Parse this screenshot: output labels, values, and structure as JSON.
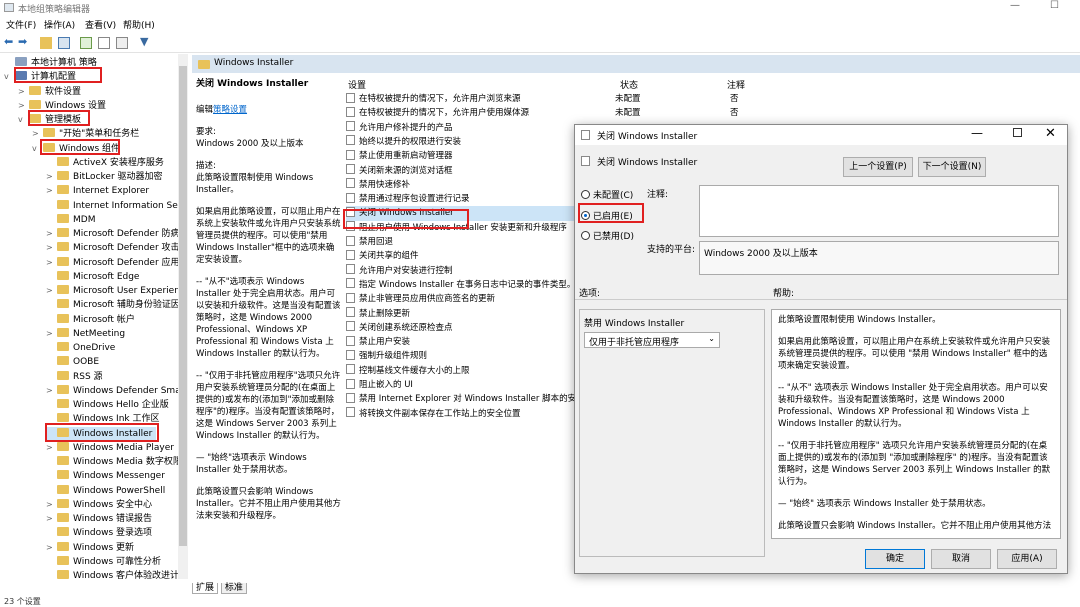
{
  "window": {
    "title": "本地组策略编辑器",
    "min": "—",
    "max": "☐"
  },
  "menu": {
    "file": "文件(F)",
    "action": "操作(A)",
    "view": "查看(V)",
    "help": "帮助(H)"
  },
  "tree": {
    "items": [
      {
        "label": "本地计算机 策略",
        "level": 0,
        "exp": ""
      },
      {
        "label": "计算机配置",
        "level": 0,
        "exp": "v"
      },
      {
        "label": "软件设置",
        "level": 1,
        "exp": ">"
      },
      {
        "label": "Windows 设置",
        "level": 1,
        "exp": ">"
      },
      {
        "label": "管理模板",
        "level": 1,
        "exp": "v"
      },
      {
        "label": "\"开始\"菜单和任务栏",
        "level": 2,
        "exp": ">"
      },
      {
        "label": "Windows 组件",
        "level": 2,
        "exp": "v"
      },
      {
        "label": "ActiveX 安装程序服务",
        "level": 3,
        "exp": ""
      },
      {
        "label": "BitLocker 驱动器加密",
        "level": 3,
        "exp": ">"
      },
      {
        "label": "Internet Explorer",
        "level": 3,
        "exp": ">"
      },
      {
        "label": "Internet Information Serv",
        "level": 3,
        "exp": ""
      },
      {
        "label": "MDM",
        "level": 3,
        "exp": ""
      },
      {
        "label": "Microsoft Defender 防病",
        "level": 3,
        "exp": ">"
      },
      {
        "label": "Microsoft Defender 攻击",
        "level": 3,
        "exp": ">"
      },
      {
        "label": "Microsoft Defender 应用",
        "level": 3,
        "exp": ">"
      },
      {
        "label": "Microsoft Edge",
        "level": 3,
        "exp": ""
      },
      {
        "label": "Microsoft User Experienc",
        "level": 3,
        "exp": ">"
      },
      {
        "label": "Microsoft 辅助身份验证因",
        "level": 3,
        "exp": ""
      },
      {
        "label": "Microsoft 帐户",
        "level": 3,
        "exp": ""
      },
      {
        "label": "NetMeeting",
        "level": 3,
        "exp": ">"
      },
      {
        "label": "OneDrive",
        "level": 3,
        "exp": ""
      },
      {
        "label": "OOBE",
        "level": 3,
        "exp": ""
      },
      {
        "label": "RSS 源",
        "level": 3,
        "exp": ""
      },
      {
        "label": "Windows Defender Smar",
        "level": 3,
        "exp": ">"
      },
      {
        "label": "Windows Hello 企业版",
        "level": 3,
        "exp": ""
      },
      {
        "label": "Windows Ink 工作区",
        "level": 3,
        "exp": ""
      },
      {
        "label": "Windows Installer",
        "level": 3,
        "exp": ""
      },
      {
        "label": "Windows Media Player",
        "level": 3,
        "exp": ">"
      },
      {
        "label": "Windows Media 数字权限",
        "level": 3,
        "exp": ""
      },
      {
        "label": "Windows Messenger",
        "level": 3,
        "exp": ""
      },
      {
        "label": "Windows PowerShell",
        "level": 3,
        "exp": ""
      },
      {
        "label": "Windows 安全中心",
        "level": 3,
        "exp": ">"
      },
      {
        "label": "Windows 错误报告",
        "level": 3,
        "exp": ">"
      },
      {
        "label": "Windows 登录选项",
        "level": 3,
        "exp": ""
      },
      {
        "label": "Windows 更新",
        "level": 3,
        "exp": ">"
      },
      {
        "label": "Windows 可靠性分析",
        "level": 3,
        "exp": ""
      },
      {
        "label": "Windows 客户体验改进计",
        "level": 3,
        "exp": ""
      }
    ]
  },
  "main": {
    "header": "Windows Installer",
    "policy_title": "关闭 Windows Installer",
    "edit_prefix": "编辑",
    "edit_link": "策略设置",
    "req_label": "要求:",
    "req_value": "Windows 2000 及以上版本",
    "desc_label": "描述:",
    "desc1": "此策略设置限制使用 Windows Installer。",
    "desc2": "如果启用此策略设置，可以阻止用户在系统上安装软件或允许用户只安装系统管理员提供的程序。可以使用\"禁用 Windows Installer\"框中的选项来确定安装设置。",
    "desc3": "-- \"从不\"选项表示 Windows Installer 处于完全启用状态。用户可以安装和升级软件。这是当没有配置该策略时，这是 Windows 2000 Professional、Windows XP Professional 和 Windows Vista 上 Windows Installer 的默认行为。",
    "desc4": "-- \"仅用于非托管应用程序\"选项只允许用户安装系统管理员分配的(在桌面上提供的)或发布的(添加到\"添加或删除程序\"的)程序。当没有配置该策略时，这是 Windows Server 2003 系列上 Windows Installer 的默认行为。",
    "desc5": "— \"始终\"选项表示 Windows Installer 处于禁用状态。",
    "desc6": "此策略设置只会影响 Windows Installer。它并不阻止用户使用其他方法来安装和升级程序。",
    "col_setting": "设置",
    "col_state": "状态",
    "col_comment": "注释",
    "rows": [
      {
        "name": "在特权被提升的情况下，允许用户浏览来源",
        "state": "未配置",
        "comment": "否"
      },
      {
        "name": "在特权被提升的情况下，允许用户使用媒体源",
        "state": "未配置",
        "comment": "否"
      },
      {
        "name": "允许用户修补提升的产品",
        "state": "",
        "comment": ""
      },
      {
        "name": "始终以提升的权限进行安装",
        "state": "",
        "comment": ""
      },
      {
        "name": "禁止使用重新启动管理器",
        "state": "",
        "comment": ""
      },
      {
        "name": "关闭新来源的浏览对话框",
        "state": "",
        "comment": ""
      },
      {
        "name": "禁用快速修补",
        "state": "",
        "comment": ""
      },
      {
        "name": "禁用通过程序包设置进行记录",
        "state": "",
        "comment": ""
      },
      {
        "name": "关闭 Windows Installer",
        "state": "",
        "comment": ""
      },
      {
        "name": "阻止用户使用 Windows Installer 安装更新和升级程序",
        "state": "",
        "comment": ""
      },
      {
        "name": "禁用回退",
        "state": "",
        "comment": ""
      },
      {
        "name": "关闭共享的组件",
        "state": "",
        "comment": ""
      },
      {
        "name": "允许用户对安装进行控制",
        "state": "",
        "comment": ""
      },
      {
        "name": "指定 Windows Installer 在事务日志中记录的事件类型。",
        "state": "",
        "comment": ""
      },
      {
        "name": "禁止非管理员应用供应商签名的更新",
        "state": "",
        "comment": ""
      },
      {
        "name": "禁止删除更新",
        "state": "",
        "comment": ""
      },
      {
        "name": "关闭创建系统还原检查点",
        "state": "",
        "comment": ""
      },
      {
        "name": "禁止用户安装",
        "state": "",
        "comment": ""
      },
      {
        "name": "强制升级组件规则",
        "state": "",
        "comment": ""
      },
      {
        "name": "控制基线文件缓存大小的上限",
        "state": "",
        "comment": ""
      },
      {
        "name": "阻止嵌入的 UI",
        "state": "",
        "comment": ""
      },
      {
        "name": "禁用 Internet Explorer 对 Windows Installer 脚本的安",
        "state": "",
        "comment": ""
      },
      {
        "name": "将转换文件副本保存在工作站上的安全位置",
        "state": "",
        "comment": ""
      }
    ],
    "tab_ext": "扩展",
    "tab_std": "标准"
  },
  "status": "23 个设置",
  "dialog": {
    "title": "关闭 Windows Installer",
    "subtitle": "关闭 Windows Installer",
    "prev": "上一个设置(P)",
    "next": "下一个设置(N)",
    "opt_nc": "未配置(C)",
    "opt_en": "已启用(E)",
    "opt_dis": "已禁用(D)",
    "comment_label": "注释:",
    "platform_label": "支持的平台:",
    "platform_value": "Windows 2000 及以上版本",
    "options_label": "选项:",
    "help_label": "帮助:",
    "disable_label": "禁用 Windows Installer",
    "select_value": "仅用于非托管应用程序",
    "help1": "此策略设置限制使用 Windows Installer。",
    "help2": "如果启用此策略设置，可以阻止用户在系统上安装软件或允许用户只安装系统管理员提供的程序。可以使用 \"禁用 Windows Installer\" 框中的选项来确定安装设置。",
    "help3": "-- \"从不\" 选项表示 Windows Installer 处于完全启用状态。用户可以安装和升级软件。当没有配置该策略时，这是 Windows 2000 Professional、Windows XP Professional 和 Windows Vista 上 Windows Installer 的默认行为。",
    "help4": "-- \"仅用于非托管应用程序\" 选项只允许用户安装系统管理员分配的(在桌面上提供的)或发布的(添加到 \"添加或删除程序\" 的)程序。当没有配置该策略时，这是 Windows Server 2003 系列上 Windows Installer 的默认行为。",
    "help5": "— \"始终\" 选项表示 Windows Installer 处于禁用状态。",
    "help6": "此策略设置只会影响 Windows Installer。它并不阻止用户使用其他方法",
    "ok": "确定",
    "cancel": "取消",
    "apply": "应用(A)"
  }
}
